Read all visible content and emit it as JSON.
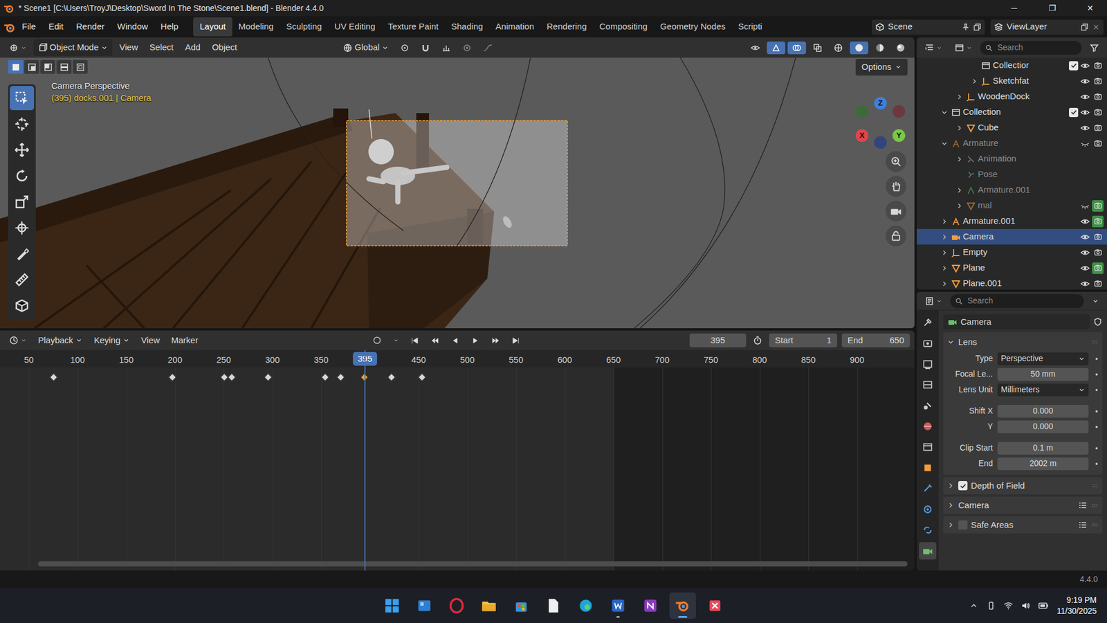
{
  "window": {
    "title": "* Scene1 [C:\\Users\\TroyJ\\Desktop\\Sword In The Stone\\Scene1.blend] - Blender 4.4.0",
    "controls": [
      "─",
      "❐",
      "✕"
    ]
  },
  "menus": [
    "File",
    "Edit",
    "Render",
    "Window",
    "Help"
  ],
  "workspaces": [
    {
      "label": "Layout",
      "selected": true
    },
    {
      "label": "Modeling",
      "selected": false
    },
    {
      "label": "Sculpting",
      "selected": false
    },
    {
      "label": "UV Editing",
      "selected": false
    },
    {
      "label": "Texture Paint",
      "selected": false
    },
    {
      "label": "Shading",
      "selected": false
    },
    {
      "label": "Animation",
      "selected": false
    },
    {
      "label": "Rendering",
      "selected": false
    },
    {
      "label": "Compositing",
      "selected": false
    },
    {
      "label": "Geometry Nodes",
      "selected": false
    },
    {
      "label": "Scripti",
      "selected": false
    }
  ],
  "scene": "Scene",
  "view_layer": "ViewLayer",
  "viewport": {
    "mode": "Object Mode",
    "menus": [
      "View",
      "Select",
      "Add",
      "Object"
    ],
    "orientation": "Global",
    "options": "Options",
    "overlay_title": "Camera Perspective",
    "overlay_info": "(395) docks.001 | Camera",
    "axes": [
      "X",
      "Y",
      "Z"
    ],
    "select_modes": [
      {
        "selected": true
      },
      {
        "selected": false
      },
      {
        "selected": false
      },
      {
        "selected": false
      },
      {
        "selected": false
      }
    ],
    "tools": [
      {
        "selected": true
      },
      {
        "selected": false
      },
      {
        "selected": false
      },
      {
        "selected": false
      },
      {
        "selected": false
      },
      {
        "selected": false
      },
      {
        "selected": false
      },
      {
        "selected": false
      },
      {
        "selected": false
      }
    ],
    "shading": [
      {
        "selected": false
      },
      {
        "selected": true
      },
      {
        "selected": false
      },
      {
        "selected": false
      }
    ]
  },
  "timeline": {
    "menus": [
      "Playback",
      "Keying",
      "View",
      "Marker"
    ],
    "frame_field": "395",
    "frame_badge": "395",
    "start_label": "Start",
    "start": "1",
    "end_label": "End",
    "end": "650",
    "ticks": [
      "50",
      "100",
      "150",
      "200",
      "250",
      "300",
      "350",
      "450",
      "500",
      "550",
      "600",
      "650",
      "700",
      "750",
      "800",
      "850",
      "900"
    ],
    "keyframes": [
      {
        "frame": 76,
        "selected": false
      },
      {
        "frame": 198,
        "selected": false
      },
      {
        "frame": 251,
        "selected": false
      },
      {
        "frame": 259,
        "selected": false
      },
      {
        "frame": 296,
        "selected": false
      },
      {
        "frame": 355,
        "selected": false
      },
      {
        "frame": 371,
        "selected": false
      },
      {
        "frame": 395,
        "selected": true
      },
      {
        "frame": 423,
        "selected": false
      },
      {
        "frame": 454,
        "selected": false
      }
    ]
  },
  "outliner": {
    "search_placeholder": "Search",
    "rows": [
      {
        "name": "Collectior",
        "level": 2,
        "arrow": false,
        "expanded": false,
        "kind": "collection",
        "checked": true,
        "toggles": true,
        "visible": true,
        "render_highlight": false,
        "greyed": false,
        "selected": false
      },
      {
        "name": "Sketchfat",
        "level": 2,
        "arrow": true,
        "expanded": false,
        "kind": "empty",
        "toggles": true,
        "visible": true,
        "render_highlight": false,
        "greyed": false,
        "selected": false
      },
      {
        "name": "WoodenDock",
        "level": 1,
        "arrow": true,
        "expanded": false,
        "kind": "empty",
        "toggles": true,
        "visible": true,
        "render_highlight": false,
        "greyed": false,
        "selected": false
      },
      {
        "name": "Collection",
        "level": 0,
        "arrow": true,
        "expanded": true,
        "kind": "collection",
        "checked": true,
        "toggles": true,
        "visible": true,
        "render_highlight": false,
        "greyed": false,
        "selected": false
      },
      {
        "name": "Cube",
        "level": 1,
        "arrow": true,
        "expanded": false,
        "kind": "mesh",
        "toggles": true,
        "visible": true,
        "render_highlight": false,
        "greyed": false,
        "selected": false
      },
      {
        "name": "Armature",
        "level": 0,
        "arrow": true,
        "expanded": true,
        "kind": "armature",
        "toggles": true,
        "visible": false,
        "render_highlight": false,
        "greyed": true,
        "selected": false
      },
      {
        "name": "Animation",
        "level": 1,
        "arrow": true,
        "expanded": false,
        "kind": "action",
        "toggles": false,
        "visible": true,
        "render_highlight": false,
        "greyed": true,
        "selected": false
      },
      {
        "name": "Pose",
        "level": 1,
        "arrow": false,
        "expanded": false,
        "kind": "pose",
        "toggles": false,
        "visible": true,
        "render_highlight": false,
        "greyed": true,
        "selected": false
      },
      {
        "name": "Armature.001",
        "level": 1,
        "arrow": true,
        "expanded": false,
        "kind": "armature_data",
        "toggles": false,
        "visible": true,
        "render_highlight": false,
        "greyed": true,
        "selected": false
      },
      {
        "name": "mal",
        "level": 1,
        "arrow": true,
        "expanded": false,
        "kind": "mesh",
        "toggles": true,
        "visible": false,
        "render_highlight": true,
        "greyed": true,
        "selected": false
      },
      {
        "name": "Armature.001",
        "level": 0,
        "arrow": true,
        "expanded": false,
        "kind": "armature",
        "toggles": true,
        "visible": true,
        "render_highlight": true,
        "greyed": false,
        "selected": false
      },
      {
        "name": "Camera",
        "level": 0,
        "arrow": true,
        "expanded": false,
        "kind": "camera",
        "toggles": true,
        "visible": true,
        "render_highlight": false,
        "greyed": false,
        "selected": true
      },
      {
        "name": "Empty",
        "level": 0,
        "arrow": true,
        "expanded": false,
        "kind": "empty",
        "toggles": true,
        "visible": true,
        "render_highlight": false,
        "greyed": false,
        "selected": false
      },
      {
        "name": "Plane",
        "level": 0,
        "arrow": true,
        "expanded": false,
        "kind": "mesh",
        "toggles": true,
        "visible": true,
        "render_highlight": true,
        "greyed": false,
        "selected": false
      },
      {
        "name": "Plane.001",
        "level": 0,
        "arrow": true,
        "expanded": false,
        "kind": "mesh",
        "toggles": true,
        "visible": true,
        "render_highlight": false,
        "greyed": false,
        "selected": false
      }
    ]
  },
  "properties": {
    "search_placeholder": "Search",
    "datablock": "Camera",
    "tabs": [
      {
        "selected": false
      },
      {
        "selected": false
      },
      {
        "selected": false
      },
      {
        "selected": false
      },
      {
        "selected": false
      },
      {
        "selected": false
      },
      {
        "selected": false
      },
      {
        "selected": false
      },
      {
        "selected": false
      },
      {
        "selected": false
      },
      {
        "selected": false
      },
      {
        "selected": true
      }
    ],
    "panel": {
      "title": "Lens",
      "expanded": true
    },
    "fields": [
      {
        "label": "Type",
        "value": "Perspective",
        "kind": "dropdown"
      },
      {
        "label": "Focal Le...",
        "value": "50 mm",
        "kind": "number"
      },
      {
        "label": "Lens Unit",
        "value": "Millimeters",
        "kind": "dropdown"
      },
      {
        "label": "Shift X",
        "value": "0.000",
        "kind": "number"
      },
      {
        "label": "Y",
        "value": "0.000",
        "kind": "number"
      },
      {
        "label": "Clip Start",
        "value": "0.1 m",
        "kind": "number"
      },
      {
        "label": "End",
        "value": "2002 m",
        "kind": "number"
      }
    ],
    "subpanels": [
      {
        "title": "Depth of Field",
        "checkbox": true,
        "checked": true,
        "expanded": false
      },
      {
        "title": "Camera",
        "checkbox": false,
        "expanded": false
      },
      {
        "title": "Safe Areas",
        "checkbox": true,
        "checked": false,
        "expanded": false
      }
    ]
  },
  "status_bar": {
    "version": "4.4.0"
  },
  "taskbar": {
    "apps": [
      {
        "running": false,
        "active": false
      },
      {
        "running": false,
        "active": false
      },
      {
        "running": false,
        "active": false
      },
      {
        "running": false,
        "active": false
      },
      {
        "running": false,
        "active": false
      },
      {
        "running": false,
        "active": false
      },
      {
        "running": false,
        "active": false
      },
      {
        "running": true,
        "active": false
      },
      {
        "running": false,
        "active": false
      },
      {
        "running": true,
        "active": true
      },
      {
        "running": false,
        "active": false
      }
    ],
    "time": "9:19 PM",
    "date": "11/30/2025"
  }
}
